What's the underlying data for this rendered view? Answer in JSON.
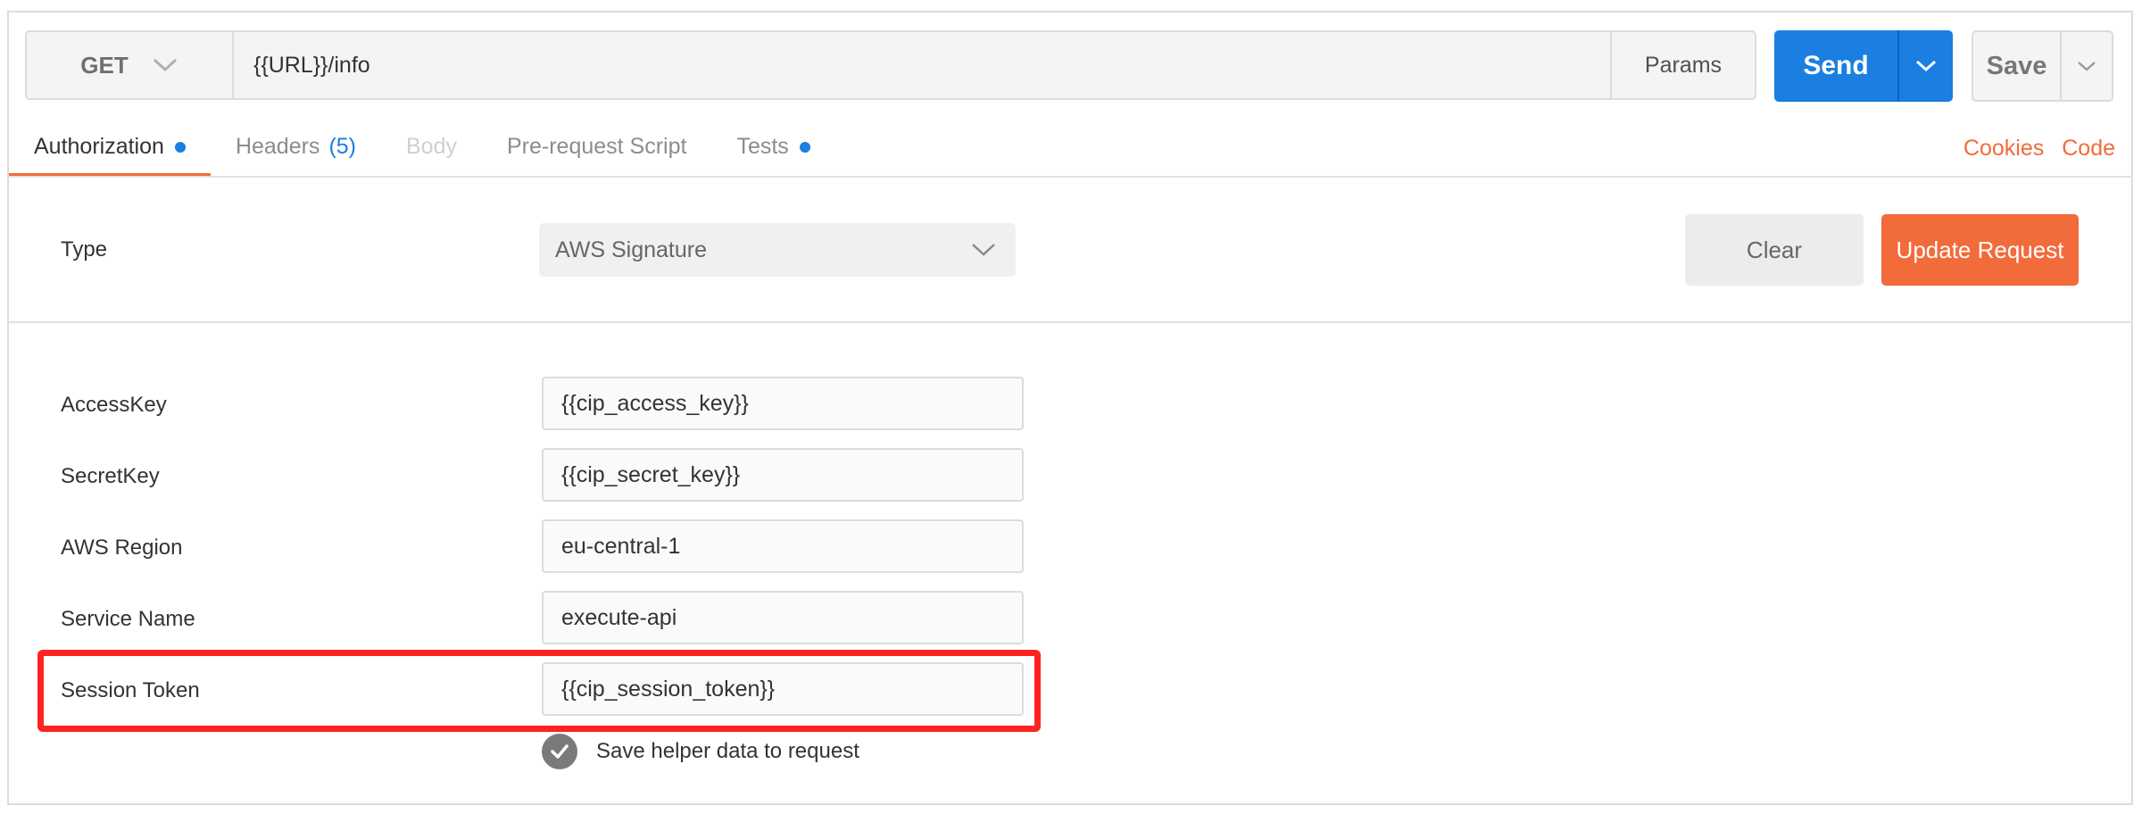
{
  "request": {
    "method": "GET",
    "url": "{{URL}}/info",
    "params_label": "Params",
    "send_label": "Send",
    "save_label": "Save"
  },
  "tabs": [
    {
      "label": "Authorization",
      "dot": true
    },
    {
      "label": "Headers",
      "count": "(5)"
    },
    {
      "label": "Body"
    },
    {
      "label": "Pre-request Script"
    },
    {
      "label": "Tests",
      "dot": true
    }
  ],
  "links": {
    "cookies": "Cookies",
    "code": "Code"
  },
  "auth": {
    "type_label": "Type",
    "type_value": "AWS Signature",
    "clear_label": "Clear",
    "update_label": "Update Request",
    "fields": [
      {
        "label": "AccessKey",
        "value": "{{cip_access_key}}"
      },
      {
        "label": "SecretKey",
        "value": "{{cip_secret_key}}"
      },
      {
        "label": "AWS Region",
        "value": "eu-central-1"
      },
      {
        "label": "Service Name",
        "value": "execute-api"
      },
      {
        "label": "Session Token",
        "value": "{{cip_session_token}}"
      }
    ],
    "save_helper_label": "Save helper data to request",
    "save_helper_checked": true
  },
  "colors": {
    "accent": "#f26b3a",
    "primary": "#1a7fe0",
    "highlight": "#ff2222"
  },
  "icons": {
    "method": "chevron-down-icon",
    "checkbox": "check-icon"
  }
}
